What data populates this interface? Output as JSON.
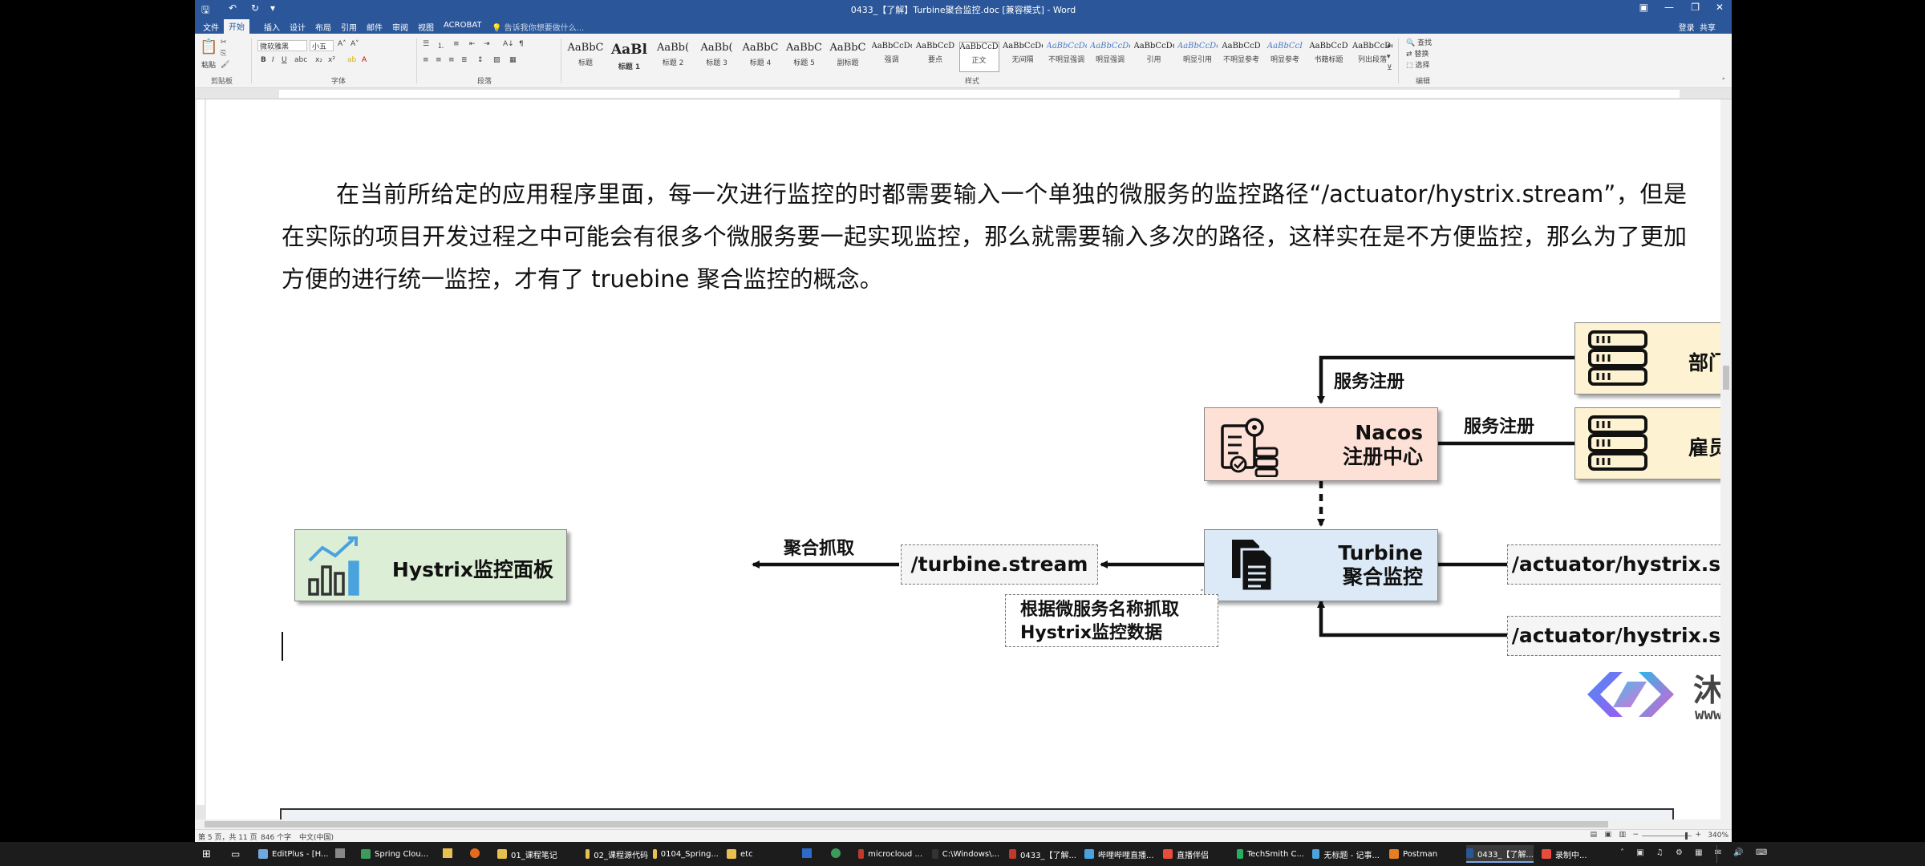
{
  "window": {
    "title": "0433_【了解】Turbine聚合监控.doc [兼容模式] - Word",
    "account_login": "登录",
    "account_share": "共享"
  },
  "menu": {
    "tabs": [
      "文件",
      "开始",
      "插入",
      "设计",
      "布局",
      "引用",
      "邮件",
      "审阅",
      "视图",
      "ACROBAT"
    ],
    "tell_me": "告诉我你想要做什么..."
  },
  "ribbon": {
    "clipboard": {
      "paste": "粘贴",
      "label": "剪贴板"
    },
    "font": {
      "name": "微软雅黑",
      "size": "小五",
      "label": "字体"
    },
    "paragraph": {
      "label": "段落"
    },
    "styles": {
      "label": "样式",
      "items": [
        {
          "sample": "AaBbC",
          "name": "标题"
        },
        {
          "sample": "AaBl",
          "name": "标题 1"
        },
        {
          "sample": "AaBb(",
          "name": "标题 2"
        },
        {
          "sample": "AaBb(",
          "name": "标题 3"
        },
        {
          "sample": "AaBbC",
          "name": "标题 4"
        },
        {
          "sample": "AaBbC",
          "name": "标题 5"
        },
        {
          "sample": "AaBbC",
          "name": "副标题"
        },
        {
          "sample": "AaBbCcDc",
          "name": "强调"
        },
        {
          "sample": "AaBbCcD",
          "name": "要点"
        },
        {
          "sample": "AaBbCcDc",
          "name": "正文"
        },
        {
          "sample": "AaBbCcDc",
          "name": "无间隔"
        },
        {
          "sample": "AaBbCcDc",
          "name": "不明显强调"
        },
        {
          "sample": "AaBbCcDc",
          "name": "明显强调"
        },
        {
          "sample": "AaBbCcDc",
          "name": "引用"
        },
        {
          "sample": "AaBbCcDc",
          "name": "明显引用"
        },
        {
          "sample": "AaBbCcD",
          "name": "不明显参考"
        },
        {
          "sample": "AaBbCcI",
          "name": "明显参考"
        },
        {
          "sample": "AaBbCcD",
          "name": "书籍标题"
        },
        {
          "sample": "AaBbCcDc",
          "name": "列出段落"
        }
      ]
    },
    "editing": {
      "find": "查找",
      "replace": "替换",
      "select": "选择",
      "label": "编辑"
    }
  },
  "document": {
    "paragraph": "在当前所给定的应用程序里面，每一次进行监控的时都需要输入一个单独的微服务的监控路径“/actuator/hystrix.stream”，但是在实际的项目开发过程之中可能会有很多个微服务要一起实现监控，那么就需要输入多次的路径，这样实在是不方便监控，那么为了更加方便的进行统一监控，才有了 truebine 聚合监控的概念。"
  },
  "diagram": {
    "nodes": {
      "dept_service": "部门微服务",
      "emp_service": "雇员微服务",
      "nacos_line1": "Nacos",
      "nacos_line2": "注册中心",
      "turbine_line1": "Turbine",
      "turbine_line2": "聚合监控",
      "hystrix_panel": "Hystrix监控面板"
    },
    "boxes": {
      "turbine_stream": "/turbine.stream",
      "actuator_stream_1": "/actuator/hystrix.stream",
      "actuator_stream_2": "/actuator/hystrix.stream"
    },
    "labels": {
      "register_1": "服务注册",
      "register_2": "服务注册",
      "aggregate_fetch": "聚合抓取",
      "callout_line1": "根据微服务名称抓取",
      "callout_line2": "Hystrix监控数据"
    },
    "colors": {
      "service": "#fdf3d2",
      "nacos": "#fde0d6",
      "turbine": "#dce9f6",
      "hystrix": "#dcefd6"
    }
  },
  "watermark": {
    "brand": "沐言科技",
    "url": "www.yootk.com"
  },
  "statusbar": {
    "page": "第 5 页，共 11 页",
    "words": "846 个字",
    "language": "中文(中国)",
    "zoom": "340%"
  },
  "taskbar": {
    "items": [
      "EditPlus - [H...",
      "Spring Clou...",
      "01_课程笔记",
      "02_课程源代码",
      "0104_Spring...",
      "etc",
      "microcloud ...",
      "C:\\Windows\\...",
      "0433_【了解...",
      "哔哩哔哩直播...",
      "直播伴侣",
      "TechSmith C...",
      "无标题 - 记事...",
      "Postman",
      "0433_【了解...",
      "录制中..."
    ]
  }
}
